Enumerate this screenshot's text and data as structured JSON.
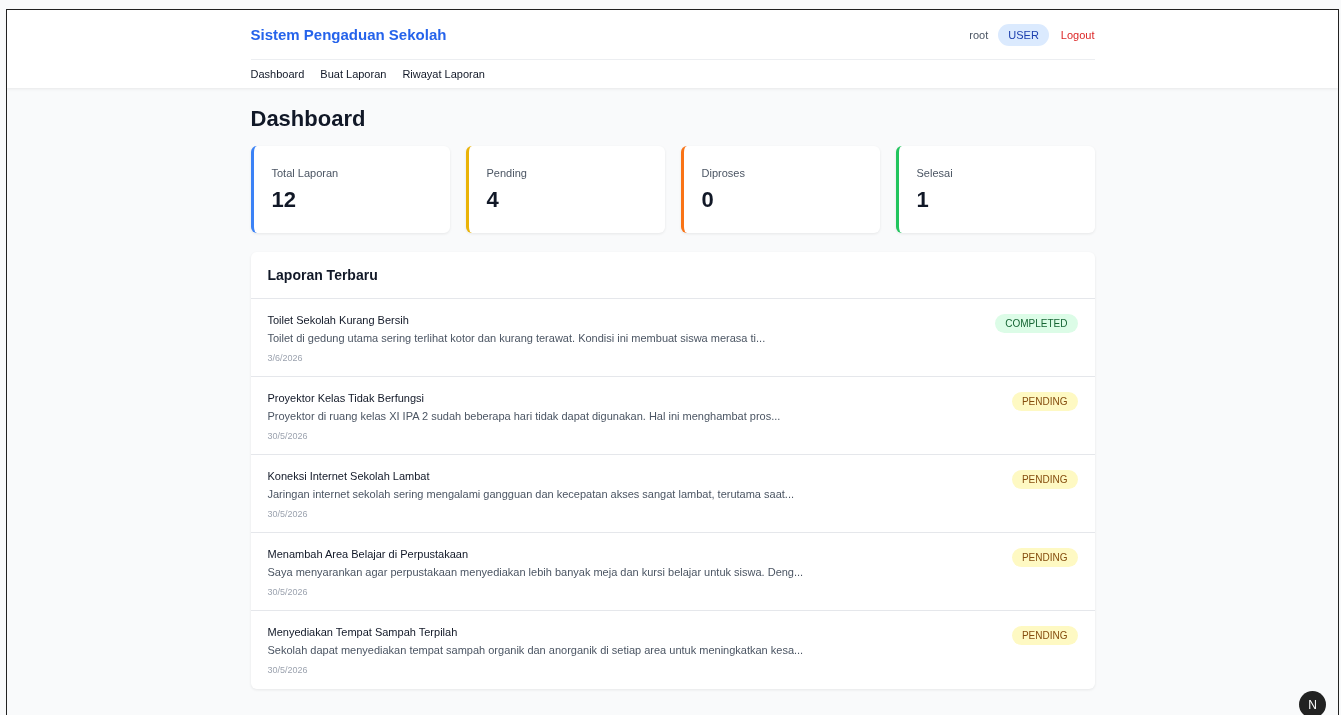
{
  "header": {
    "brand": "Sistem Pengaduan Sekolah",
    "username": "root",
    "role": "USER",
    "logout": "Logout"
  },
  "nav": [
    {
      "label": "Dashboard"
    },
    {
      "label": "Buat Laporan"
    },
    {
      "label": "Riwayat Laporan"
    }
  ],
  "page_title": "Dashboard",
  "stats": [
    {
      "label": "Total Laporan",
      "value": "12",
      "color": "#3b82f6"
    },
    {
      "label": "Pending",
      "value": "4",
      "color": "#eab308"
    },
    {
      "label": "Diproses",
      "value": "0",
      "color": "#f97316"
    },
    {
      "label": "Selesai",
      "value": "1",
      "color": "#22c55e"
    }
  ],
  "recent": {
    "title": "Laporan Terbaru",
    "items": [
      {
        "title": "Toilet Sekolah Kurang Bersih",
        "excerpt": "Toilet di gedung utama sering terlihat kotor dan kurang terawat. Kondisi ini membuat siswa merasa ti...",
        "date": "3/6/2026",
        "status": "COMPLETED",
        "kind": "completed"
      },
      {
        "title": "Proyektor Kelas Tidak Berfungsi",
        "excerpt": "Proyektor di ruang kelas XI IPA 2 sudah beberapa hari tidak dapat digunakan. Hal ini menghambat pros...",
        "date": "30/5/2026",
        "status": "PENDING",
        "kind": "pending"
      },
      {
        "title": "Koneksi Internet Sekolah Lambat",
        "excerpt": "Jaringan internet sekolah sering mengalami gangguan dan kecepatan akses sangat lambat, terutama saat...",
        "date": "30/5/2026",
        "status": "PENDING",
        "kind": "pending"
      },
      {
        "title": "Menambah Area Belajar di Perpustakaan",
        "excerpt": "Saya menyarankan agar perpustakaan menyediakan lebih banyak meja dan kursi belajar untuk siswa. Deng...",
        "date": "30/5/2026",
        "status": "PENDING",
        "kind": "pending"
      },
      {
        "title": "Menyediakan Tempat Sampah Terpilah",
        "excerpt": "Sekolah dapat menyediakan tempat sampah organik dan anorganik di setiap area untuk meningkatkan kesa...",
        "date": "30/5/2026",
        "status": "PENDING",
        "kind": "pending"
      }
    ]
  },
  "dev_badge": "N"
}
